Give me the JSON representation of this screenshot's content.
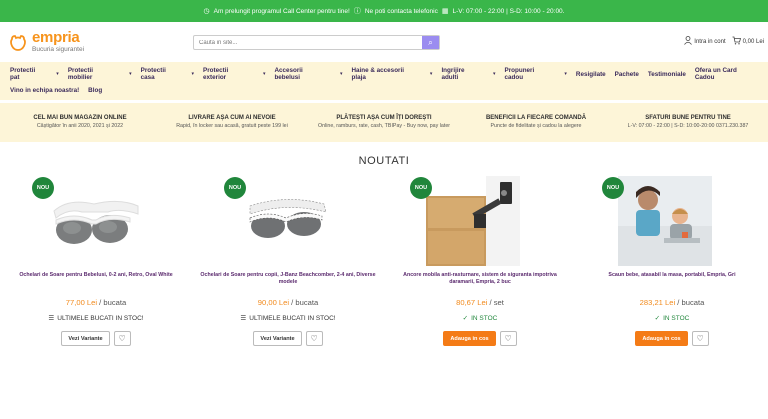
{
  "topbar": {
    "msg1": "Am prelungit programul Call Center pentru tine!",
    "msg2": "Ne poti contacta telefonic",
    "msg3": "L-V: 07:00 - 22:00 | S-D: 10:00 - 20:00."
  },
  "header": {
    "logo_name": "empria",
    "logo_tagline": "Bucuria sigurantei",
    "search_placeholder": "Cauta in site...",
    "account_label": "Intra in cont",
    "cart_label": "0,00 Lei",
    "cart_count": "0"
  },
  "nav": {
    "row1": [
      "Protectii pat",
      "Protectii mobilier",
      "Protectii casa",
      "Protectii exterior",
      "Accesorii bebelusi",
      "Haine & accesorii plaja",
      "Ingrijire adulti",
      "Propuneri cadou",
      "Resigilate",
      "Pachete",
      "Testimoniale",
      "Ofera un Card Cadou"
    ],
    "row1_dropdown": [
      true,
      true,
      true,
      true,
      true,
      true,
      true,
      true,
      false,
      false,
      false,
      false
    ],
    "row2": [
      "Vino in echipa noastra!",
      "Blog"
    ]
  },
  "benefits": [
    {
      "title": "CEL MAI BUN MAGAZIN ONLINE",
      "sub": "Câștigător în anii 2020, 2021 și 2022"
    },
    {
      "title": "LIVRARE AȘA CUM AI NEVOIE",
      "sub": "Rapid, în locker sau acasă, gratuit peste 199 lei"
    },
    {
      "title": "PLĂTEȘTI AȘA CUM ÎȚI DOREȘTI",
      "sub": "Online, ramburs, rate, cash, TBIPay - Buy now, pay later"
    },
    {
      "title": "BENEFICII LA FIECARE COMANDĂ",
      "sub": "Puncte de fidelitate și cadou la alegere"
    },
    {
      "title": "SFATURI BUNE PENTRU TINE",
      "sub": "L-V: 07:00 - 22:00 | S-D: 10:00-20:00 0371.230.387"
    }
  ],
  "section_title": "NOUTATI",
  "products": [
    {
      "badge": "NOU",
      "name": "Ochelari de Soare pentru Bebelusi, 0-2 ani, Retro, Oval White",
      "price": "77,00 Lei",
      "unit": "/ bucata",
      "stock": "ULTIMELE BUCATI IN STOC!",
      "stock_type": "low",
      "button": "Vezi Variante"
    },
    {
      "badge": "NOU",
      "name": "Ochelari de Soare pentru copii, J-Banz Beachcomber, 2-4 ani, Diverse modele",
      "price": "90,00 Lei",
      "unit": "/ bucata",
      "stock": "ULTIMELE BUCATI IN STOC!",
      "stock_type": "low",
      "button": "Vezi Variante"
    },
    {
      "badge": "NOU",
      "name": "Ancore mobila anti-rasturnare, sistem de siguranta impotriva daramarii, Empria, 2 buc",
      "price": "80,67 Lei",
      "unit": "/ set",
      "stock": "IN STOC",
      "stock_type": "in",
      "button": "Adauga in cos"
    },
    {
      "badge": "NOU",
      "name": "Scaun bebe, atasabil la masa, portabil, Empria, Gri",
      "price": "283,21 Lei",
      "unit": "/ bucata",
      "stock": "IN STOC",
      "stock_type": "in",
      "button": "Adauga in cos"
    }
  ],
  "colors": {
    "topbar": "#3ab64a",
    "brand_orange": "#f7941d",
    "nav_bg": "#fdf5d8",
    "badge": "#20863b",
    "cart_button": "#f47b16"
  }
}
